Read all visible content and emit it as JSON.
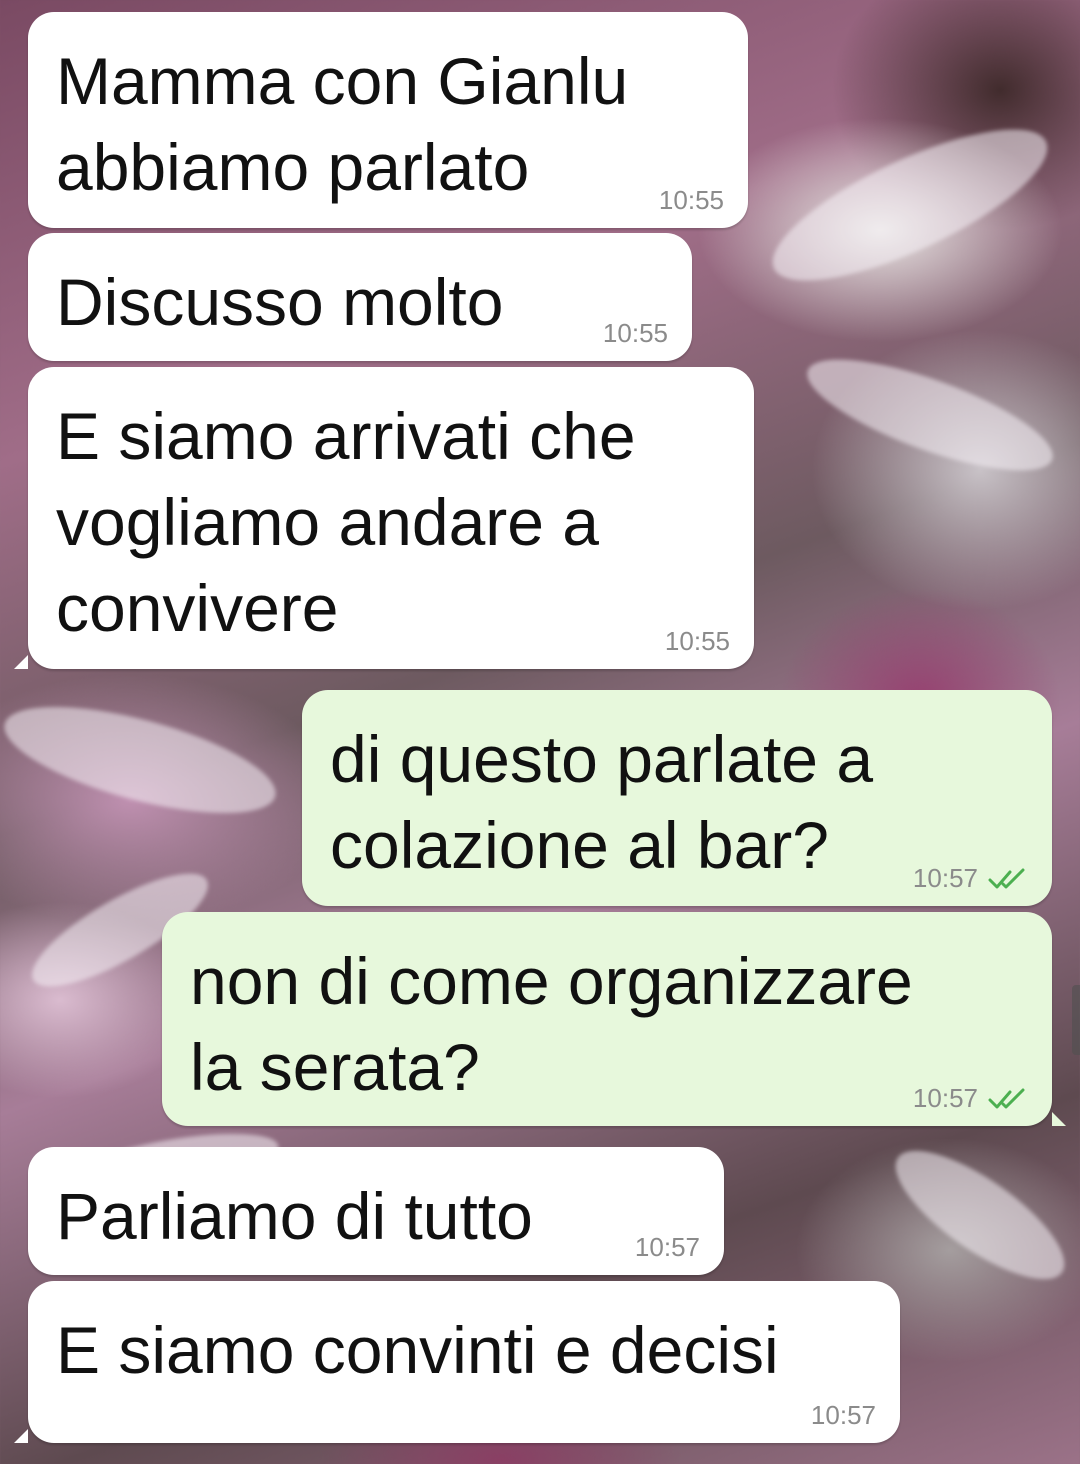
{
  "messages": [
    {
      "direction": "in",
      "text": "Mamma con Gianlu\nabbiamo parlato",
      "time": "10:55"
    },
    {
      "direction": "in",
      "text": "Discusso molto",
      "time": "10:55"
    },
    {
      "direction": "in",
      "text": "E siamo arrivati che\nvogliamo andare a\nconvivere",
      "time": "10:55"
    },
    {
      "direction": "out",
      "text": "di questo parlate a\ncolazione al bar?",
      "time": "10:57",
      "status": "read"
    },
    {
      "direction": "out",
      "text": "non di come organizzare\nla serata?",
      "time": "10:57",
      "status": "read"
    },
    {
      "direction": "in",
      "text": "Parliamo di tutto",
      "time": "10:57"
    },
    {
      "direction": "in",
      "text": "E siamo convinti e decisi",
      "time": "10:57"
    }
  ],
  "colors": {
    "incoming_bubble": "#ffffff",
    "outgoing_bubble": "#e7f8dc",
    "read_tick": "#4fc3f7",
    "timestamp": "#8b8b8b"
  },
  "icons": {
    "read_receipt": "double-check-icon"
  }
}
